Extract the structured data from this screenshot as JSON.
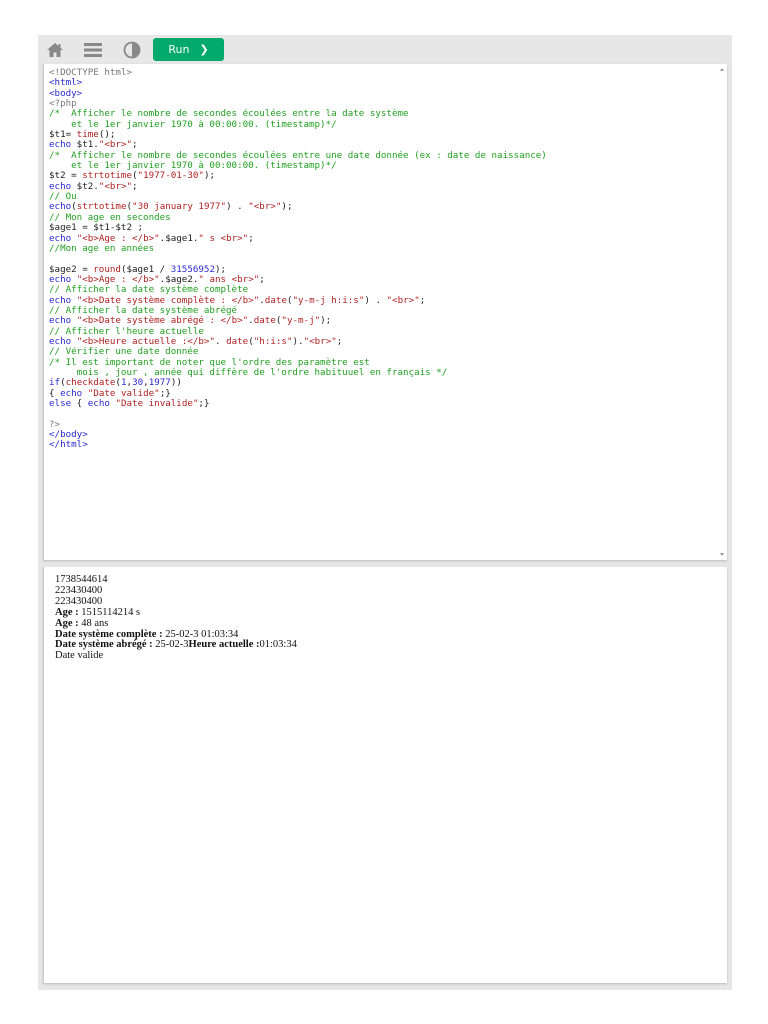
{
  "toolbar": {
    "run_label": "Run",
    "run_icon": "chevron-right-icon",
    "icons": [
      "home-icon",
      "menu-icon",
      "contrast-icon"
    ]
  },
  "code_lines": [
    [
      [
        "m",
        "<!DOCTYPE html>"
      ]
    ],
    [
      [
        "t",
        "<html>"
      ]
    ],
    [
      [
        "t",
        "<body>"
      ]
    ],
    [
      [
        "m",
        "<?php"
      ]
    ],
    [
      [
        "c",
        "/*  Afficher le nombre de secondes écoulées entre la date système"
      ]
    ],
    [
      [
        "c",
        "    et le 1er janvier 1970 à 00:00:00. (timestamp)*/"
      ]
    ],
    [
      [
        "d",
        "$t1= "
      ],
      [
        "f",
        "time"
      ],
      [
        "d",
        "();"
      ]
    ],
    [
      [
        "k",
        "echo"
      ],
      [
        "d",
        " $t1."
      ],
      [
        "s",
        "\"<br>\""
      ],
      [
        "d",
        ";"
      ]
    ],
    [
      [
        "c",
        "/*  Afficher le nombre de secondes écoulées entre une date donnée (ex : date de naissance)"
      ]
    ],
    [
      [
        "c",
        "    et le 1er janvier 1970 à 00:00:00. (timestamp)*/"
      ]
    ],
    [
      [
        "d",
        "$t2 = "
      ],
      [
        "f",
        "strtotime"
      ],
      [
        "d",
        "("
      ],
      [
        "s",
        "\"1977-01-30\""
      ],
      [
        "d",
        ");"
      ]
    ],
    [
      [
        "k",
        "echo"
      ],
      [
        "d",
        " $t2."
      ],
      [
        "s",
        "\"<br>\""
      ],
      [
        "d",
        ";"
      ]
    ],
    [
      [
        "c",
        "// Ou"
      ]
    ],
    [
      [
        "k",
        "echo"
      ],
      [
        "d",
        "("
      ],
      [
        "f",
        "strtotime"
      ],
      [
        "d",
        "("
      ],
      [
        "s",
        "\"30 january 1977\""
      ],
      [
        "d",
        ") . "
      ],
      [
        "s",
        "\"<br>\""
      ],
      [
        "d",
        ");"
      ]
    ],
    [
      [
        "c",
        "// Mon age en secondes"
      ]
    ],
    [
      [
        "d",
        "$age1 = $t1-$t2 ;"
      ]
    ],
    [
      [
        "k",
        "echo"
      ],
      [
        "d",
        " "
      ],
      [
        "s",
        "\"<b>Age : </b>\""
      ],
      [
        "d",
        ".$age1."
      ],
      [
        "s",
        "\" s <br>\""
      ],
      [
        "d",
        ";"
      ]
    ],
    [
      [
        "c",
        "//Mon age en années"
      ]
    ],
    [],
    [
      [
        "d",
        "$age2 = "
      ],
      [
        "f",
        "round"
      ],
      [
        "d",
        "($age1 / "
      ],
      [
        "n",
        "31556952"
      ],
      [
        "d",
        ");"
      ]
    ],
    [
      [
        "k",
        "echo"
      ],
      [
        "d",
        " "
      ],
      [
        "s",
        "\"<b>Age : </b>\""
      ],
      [
        "d",
        ".$age2."
      ],
      [
        "s",
        "\" ans <br>\""
      ],
      [
        "d",
        ";"
      ]
    ],
    [
      [
        "c",
        "// Afficher la date système complète"
      ]
    ],
    [
      [
        "k",
        "echo"
      ],
      [
        "d",
        " "
      ],
      [
        "s",
        "\"<b>Date système complète : </b>\""
      ],
      [
        "d",
        "."
      ],
      [
        "f",
        "date"
      ],
      [
        "d",
        "("
      ],
      [
        "s",
        "\"y-m-j h:i:s\""
      ],
      [
        "d",
        ") . "
      ],
      [
        "s",
        "\"<br>\""
      ],
      [
        "d",
        ";"
      ]
    ],
    [
      [
        "c",
        "// Afficher la date système abrégé"
      ]
    ],
    [
      [
        "k",
        "echo"
      ],
      [
        "d",
        " "
      ],
      [
        "s",
        "\"<b>Date système abrégé : </b>\""
      ],
      [
        "d",
        "."
      ],
      [
        "f",
        "date"
      ],
      [
        "d",
        "("
      ],
      [
        "s",
        "\"y-m-j\""
      ],
      [
        "d",
        ");"
      ]
    ],
    [
      [
        "c",
        "// Afficher l'heure actuelle"
      ]
    ],
    [
      [
        "k",
        "echo"
      ],
      [
        "d",
        " "
      ],
      [
        "s",
        "\"<b>Heure actuelle :</b>\""
      ],
      [
        "d",
        ". "
      ],
      [
        "f",
        "date"
      ],
      [
        "d",
        "("
      ],
      [
        "s",
        "\"h:i:s\""
      ],
      [
        "d",
        ")."
      ],
      [
        "s",
        "\"<br>\""
      ],
      [
        "d",
        ";"
      ]
    ],
    [
      [
        "c",
        "// Vérifier une date donnée"
      ]
    ],
    [
      [
        "c",
        "/* Il est important de noter que l'ordre des paramètre est"
      ]
    ],
    [
      [
        "c",
        "     mois , jour , année qui diffère de l'ordre habituuel en français */"
      ]
    ],
    [
      [
        "k",
        "if"
      ],
      [
        "d",
        "("
      ],
      [
        "f",
        "checkdate"
      ],
      [
        "d",
        "("
      ],
      [
        "n",
        "1"
      ],
      [
        "d",
        ","
      ],
      [
        "n",
        "30"
      ],
      [
        "d",
        ","
      ],
      [
        "n",
        "1977"
      ],
      [
        "d",
        "))"
      ]
    ],
    [
      [
        "d",
        "{ "
      ],
      [
        "k",
        "echo"
      ],
      [
        "d",
        " "
      ],
      [
        "s",
        "\"Date valide\""
      ],
      [
        "d",
        ";}"
      ]
    ],
    [
      [
        "k",
        "else"
      ],
      [
        "d",
        " { "
      ],
      [
        "k",
        "echo"
      ],
      [
        "d",
        " "
      ],
      [
        "s",
        "\"Date invalide\""
      ],
      [
        "d",
        ";}"
      ]
    ],
    [],
    [
      [
        "m",
        "?>"
      ]
    ],
    [
      [
        "t",
        "</body>"
      ]
    ],
    [
      [
        "t",
        "</html>"
      ]
    ]
  ],
  "output_lines": [
    [
      [
        "n",
        "1738544614"
      ]
    ],
    [
      [
        "n",
        "223430400"
      ]
    ],
    [
      [
        "n",
        "223430400"
      ]
    ],
    [
      [
        "b",
        "Age : "
      ],
      [
        "n",
        "1515114214 s"
      ]
    ],
    [
      [
        "b",
        "Age : "
      ],
      [
        "n",
        "48 ans"
      ]
    ],
    [
      [
        "b",
        "Date système complète : "
      ],
      [
        "n",
        "25-02-3 01:03:34"
      ]
    ],
    [
      [
        "b",
        "Date système abrégé : "
      ],
      [
        "n",
        "25-02-3"
      ],
      [
        "b",
        "Heure actuelle :"
      ],
      [
        "n",
        "01:03:34"
      ]
    ],
    [
      [
        "n",
        "Date valide"
      ]
    ]
  ]
}
